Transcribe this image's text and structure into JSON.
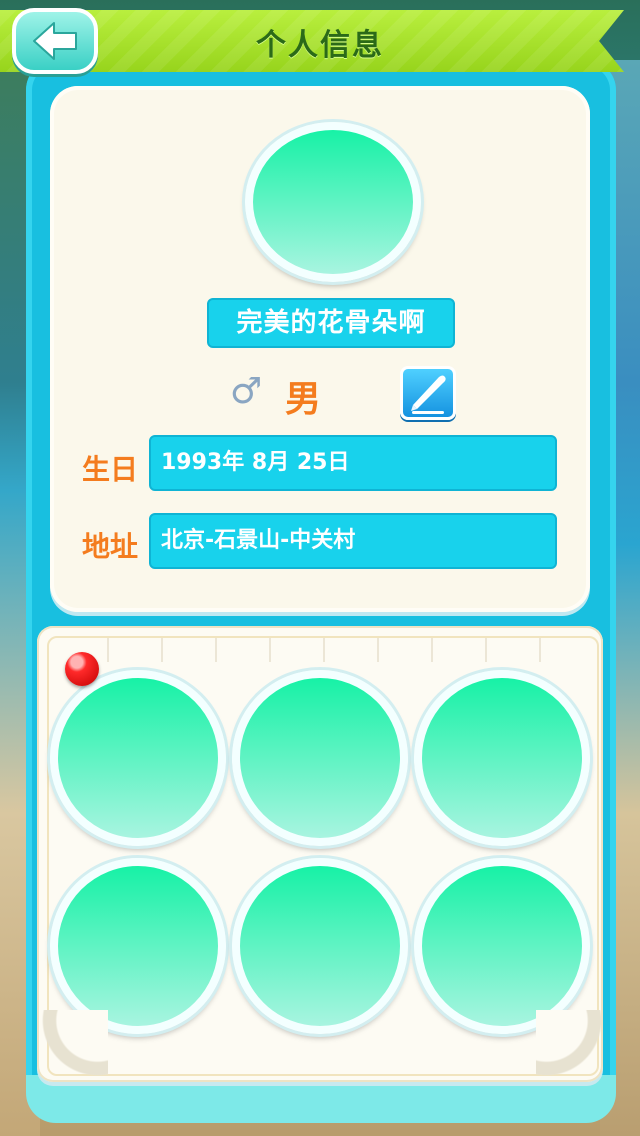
{
  "header": {
    "title": "个人信息",
    "back_icon": "back-arrow-icon"
  },
  "profile": {
    "name": "完美的花骨朵啊",
    "gender_symbol": "♂",
    "gender_label": "男",
    "edit_icon": "pencil-edit-icon",
    "fields": [
      {
        "label": "生日",
        "value": "1993年 8月 25日"
      },
      {
        "label": "地址",
        "value": "北京-石景山-中关村"
      }
    ]
  },
  "gallery": {
    "pin_icon": "red-pushpin-icon",
    "photos": [
      "photo-1",
      "photo-2",
      "photo-3",
      "photo-4",
      "photo-5",
      "photo-6"
    ]
  },
  "colors": {
    "banner": "#97d41c",
    "title": "#2b6a18",
    "panel": "#18bfe0",
    "field_bg": "#18d2ec",
    "label_orange": "#f47c1e",
    "avatar_green": "#17f2a6"
  }
}
